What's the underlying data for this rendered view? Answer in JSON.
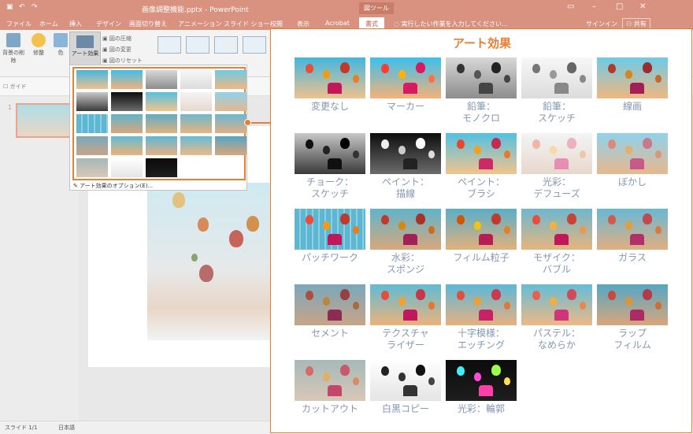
{
  "window": {
    "title": "画像調整機能.pptx - PowerPoint",
    "context_tab_group": "図ツール",
    "signin": "サインイン",
    "share": "共有",
    "tell_me": "実行したい作業を入力してください..."
  },
  "tabs": [
    "ファイル",
    "ホーム",
    "挿入",
    "デザイン",
    "画面切り替え",
    "アニメーション",
    "スライド ショー",
    "校閲",
    "表示",
    "Acrobat",
    "書式"
  ],
  "ribbon": {
    "remove_bg": "背景の削除",
    "corrections": "修整",
    "color": "色",
    "art_effects": "アート効果",
    "compress": "図の圧縮",
    "change": "図の変更",
    "reset": "図のリセット"
  },
  "subbar": {
    "guide": "ガイド"
  },
  "slide_panel": {
    "number": "1"
  },
  "dropdown": {
    "options_link": "アート効果のオプション(E)..."
  },
  "status": {
    "slide": "スライド 1/1",
    "language": "日本語"
  },
  "panel": {
    "title": "アート効果",
    "effects": [
      {
        "label": "変更なし"
      },
      {
        "label": "マーカー"
      },
      {
        "label": "鉛筆：\nモノクロ"
      },
      {
        "label": "鉛筆：\nスケッチ"
      },
      {
        "label": "線画"
      },
      {
        "label": "チョーク：\nスケッチ"
      },
      {
        "label": "ペイント：\n描線"
      },
      {
        "label": "ペイント：\nブラシ"
      },
      {
        "label": "光彩：\nデフューズ"
      },
      {
        "label": "ぼかし"
      },
      {
        "label": "パッチワーク"
      },
      {
        "label": "水彩：\nスポンジ"
      },
      {
        "label": "フィルム粒子"
      },
      {
        "label": "モザイク：\nバブル"
      },
      {
        "label": "ガラス"
      },
      {
        "label": "セメント"
      },
      {
        "label": "テクスチャ\nライザー"
      },
      {
        "label": "十字模様：\nエッチング"
      },
      {
        "label": "パステル：\nなめらか"
      },
      {
        "label": "ラップ\nフィルム"
      },
      {
        "label": "カットアウト"
      },
      {
        "label": "白黒コピー"
      },
      {
        "label": "光彩：輪郭"
      }
    ]
  },
  "colors": {
    "accent": "#ed7d31",
    "title_bar": "#d9927f",
    "label": "#8497b0"
  }
}
